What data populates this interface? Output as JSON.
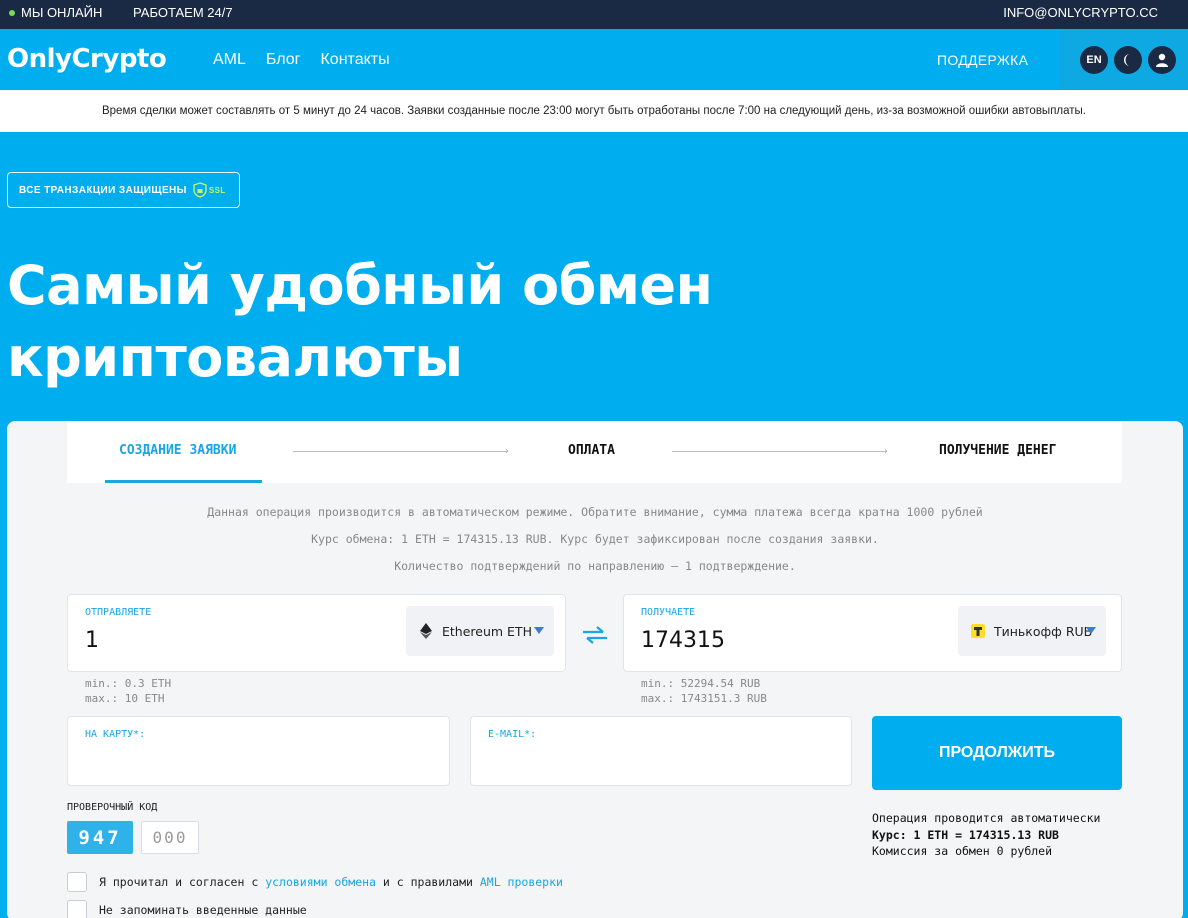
{
  "topbar": {
    "online": "МЫ ОНЛАЙН",
    "hours": "РАБОТАЕМ 24/7",
    "email": "INFO@ONLYCRYPTO.CC"
  },
  "nav": {
    "logo": "OnlyCrypto",
    "links": [
      "AML",
      "Блог",
      "Контакты"
    ],
    "support": "ПОДДЕРЖКА",
    "lang": "EN"
  },
  "notice": "Время сделки может составлять от 5 минут до 24 часов. Заявки созданные после 23:00 могут быть отработаны после 7:00 на следующий день, из-за возможной ошибки автовыплаты.",
  "ssl_badge": {
    "text": "ВСЕ ТРАНЗАКЦИИ ЗАЩИЩЕНЫ",
    "ssl": "SSL"
  },
  "hero": {
    "line1": "Самый удобный обмен",
    "line2": "криптовалюты"
  },
  "steps": [
    "СОЗДАНИЕ ЗАЯВКИ",
    "ОПЛАТА",
    "ПОЛУЧЕНИЕ ДЕНЕГ"
  ],
  "info": [
    "Данная операция производится в автоматическом режиме. Обратите внимание, сумма платежа всегда кратна 1000 рублей",
    "Курс обмена: 1 ETH = 174315.13 RUB. Курс будет зафиксирован после создания заявки.",
    "Количество подтверждений по направлению — 1 подтверждение."
  ],
  "send": {
    "label": "ОТПРАВЛЯЕТЕ",
    "value": "1",
    "currency": "Ethereum ETH",
    "min": "min.: 0.3 ETH",
    "max": "max.: 10 ETH"
  },
  "receive": {
    "label": "ПОЛУЧАЕТЕ",
    "value": "174315",
    "currency": "Тинькофф RUB",
    "min": "min.: 52294.54 RUB",
    "max": "max.: 1743151.3 RUB"
  },
  "card_field": {
    "label": "НА КАРТУ*:",
    "value": ""
  },
  "email_field": {
    "label": "E-MAIL*:",
    "value": ""
  },
  "continue_label": "ПРОДОЛЖИТЬ",
  "captcha": {
    "label": "ПРОВЕРОЧНЫЙ КОД",
    "code": "947",
    "placeholder": "000"
  },
  "operation": {
    "line1": "Операция проводится автоматически",
    "line2": "Курс: 1 ETH = 174315.13 RUB",
    "line3": "Комиссия за обмен 0 рублей"
  },
  "agree": {
    "prefix": "Я прочитал и согласен с",
    "terms_link": "условиями обмена",
    "middle": "и с правилами",
    "aml_link": "AML проверки"
  },
  "remember": "Не запоминать введенные данные"
}
